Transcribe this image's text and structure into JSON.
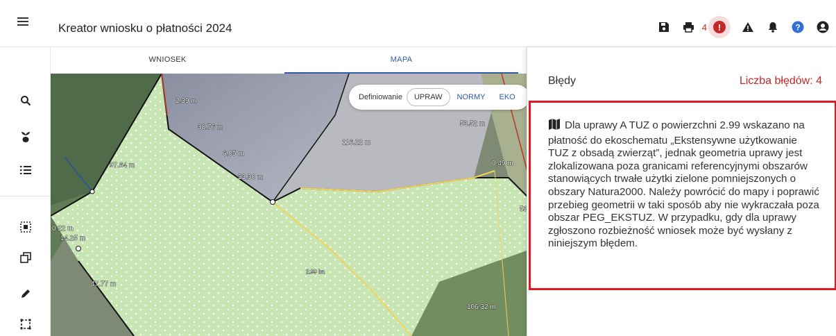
{
  "header": {
    "title": "Kreator wniosku o płatności 2024",
    "error_count": "4",
    "icons": [
      "menu-icon",
      "save-icon",
      "print-icon",
      "error-icon",
      "warning-icon",
      "bell-icon",
      "help-icon",
      "account-icon"
    ]
  },
  "tabs": [
    {
      "label": "WNIOSEK",
      "active": false
    },
    {
      "label": "MAPA",
      "active": true
    }
  ],
  "rail": {
    "icons": [
      "search-icon",
      "plant-icon",
      "list-icon",
      "select-area-icon",
      "copy-shapes-icon",
      "edit-pencil-icon",
      "crop-icon"
    ]
  },
  "map": {
    "defbar": {
      "label": "Definiowanie",
      "options": [
        {
          "label": "UPRAW",
          "active": true
        },
        {
          "label": "NORMY",
          "active": false
        },
        {
          "label": "EKO",
          "active": false
        }
      ]
    },
    "measurements": [
      {
        "id": "m1",
        "text": "2.39 m"
      },
      {
        "id": "m2",
        "text": "38.76 m"
      },
      {
        "id": "m3",
        "text": "6.05 m"
      },
      {
        "id": "m4",
        "text": "33.30 m"
      },
      {
        "id": "m5",
        "text": "97.64 m"
      },
      {
        "id": "m6",
        "text": "116.22 m"
      },
      {
        "id": "m7",
        "text": "53.52 m"
      },
      {
        "id": "m8",
        "text": "0.49 m"
      },
      {
        "id": "m9",
        "text": "0.22 m"
      },
      {
        "id": "m10",
        "text": "14.25 m"
      },
      {
        "id": "m11",
        "text": "47.77 m"
      },
      {
        "id": "m12",
        "text": "2.99 ha"
      },
      {
        "id": "m13",
        "text": "106.32 m"
      },
      {
        "id": "m14",
        "text": "53"
      }
    ],
    "colors": {
      "crop_fill": "#c8e6b4",
      "boundary": "#111111",
      "crop_line": "#f3d35a",
      "parcel_edge": "#c0392b"
    }
  },
  "errors_panel": {
    "title": "Błędy",
    "count_label": "Liczba błędów: 4",
    "accent": "#e3171f",
    "items": [
      {
        "icon": "map-icon",
        "text": "Dla uprawy A TUZ o powierzchni 2.99 wskazano na płatność do ekoschematu „Ekstensywne użytkowanie TUZ z obsadą zwierząt”, jednak geometria uprawy jest zlokalizowana poza granicami referencyjnymi obszarów stanowiących trwałe użytki zielone pomniejszonych o obszary Natura2000. Należy powrócić do mapy i poprawić przebieg geometrii w taki sposób aby nie wykraczała poza obszar PEG_EKSTUZ. W przypadku, gdy dla uprawy zgłoszono rozbieżność wniosek może być wysłany z niniejszym błędem."
      }
    ]
  }
}
